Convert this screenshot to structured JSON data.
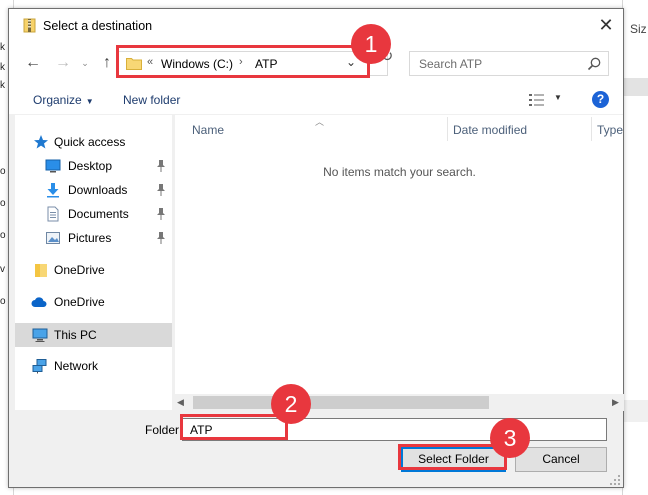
{
  "dialog": {
    "title": "Select a destination"
  },
  "navigation": {
    "address": {
      "overflow": "«",
      "segments": [
        "Windows (C:)",
        "ATP"
      ],
      "separator": "›"
    },
    "search": {
      "placeholder": "Search ATP"
    }
  },
  "toolbar": {
    "organize_label": "Organize",
    "new_folder_label": "New folder",
    "help_label": "?"
  },
  "nav_pane": {
    "items": [
      {
        "label": "Quick access",
        "icon": "star-icon"
      },
      {
        "label": "Desktop",
        "icon": "desktop-icon",
        "pinned": true
      },
      {
        "label": "Downloads",
        "icon": "downloads-icon",
        "pinned": true
      },
      {
        "label": "Documents",
        "icon": "documents-icon",
        "pinned": true
      },
      {
        "label": "Pictures",
        "icon": "pictures-icon",
        "pinned": true
      },
      {
        "label": "OneDrive",
        "icon": "folder-icon"
      },
      {
        "label": "OneDrive",
        "icon": "cloud-icon"
      },
      {
        "label": "This PC",
        "icon": "computer-icon",
        "selected": true
      },
      {
        "label": "Network",
        "icon": "network-icon"
      }
    ]
  },
  "file_list": {
    "columns": [
      "Name",
      "Date modified",
      "Type"
    ],
    "empty_message": "No items match your search."
  },
  "footer": {
    "folder_label": "Folder:",
    "folder_value": "ATP",
    "select_button": "Select Folder",
    "cancel_button": "Cancel"
  },
  "background": {
    "right_column_header": "Siz",
    "left_edge_chars": [
      "k",
      "k",
      "k",
      "o",
      "o",
      "o",
      "o",
      "o",
      "v",
      "o"
    ]
  },
  "annotations": {
    "badges": [
      "1",
      "2",
      "3"
    ],
    "color": "#e8373e"
  },
  "colors": {
    "accent": "#0078d7",
    "selection": "#d9d9d9",
    "link_text": "#1e3c6e"
  }
}
